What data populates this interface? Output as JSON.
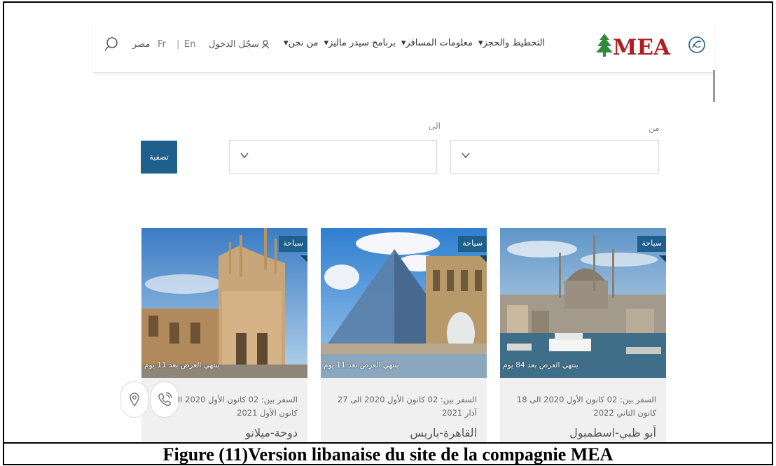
{
  "caption": "Figure (11)Version libanaise du site de la compagnie MEA",
  "header": {
    "logo_text": "MEA",
    "nav": [
      "التخطيط والحجز▾",
      "معلومات المسافر▾",
      "برنامج سيدر ماليز▾",
      "من نحن▾"
    ],
    "login": "سجّل الدخول",
    "lang_en": "En",
    "lang_sep": "|",
    "lang_fr": "Fr",
    "country": "مصر"
  },
  "filter": {
    "from_label": "من",
    "to_label": "الى",
    "button_label": "تصفية"
  },
  "offers": [
    {
      "tag": "سياحة",
      "expiry": "ينتهي العرض بعد 84 يوم",
      "dates": "السفر بين: 02 كانون الأول 2020 الى 18 كانون الثاني 2022",
      "destination": "أبو ظبي-اسطمبول"
    },
    {
      "tag": "سياحة",
      "expiry": "ينتهي العرض بعد 11 يوم",
      "dates": "السفر بين: 02 كانون الأول 2020 الى 27 آذار 2021",
      "destination": "القاهرة-باريس"
    },
    {
      "tag": "سياحة",
      "expiry": "ينتهي العرض بعد 11 يوم",
      "dates": "السفر بين: 02 كانون الأول 2020 الى 03 كانون الأول 2021",
      "destination": "دوحة-ميلانو"
    }
  ],
  "colors": {
    "brand_red": "#b01e23",
    "cedar_green": "#2e8b3a",
    "accent_blue": "#1f5f8b"
  },
  "icons": [
    "search-icon",
    "user-icon",
    "cedar-logo-icon",
    "chevron-down-icon",
    "location-pin-icon",
    "phone-icon"
  ]
}
